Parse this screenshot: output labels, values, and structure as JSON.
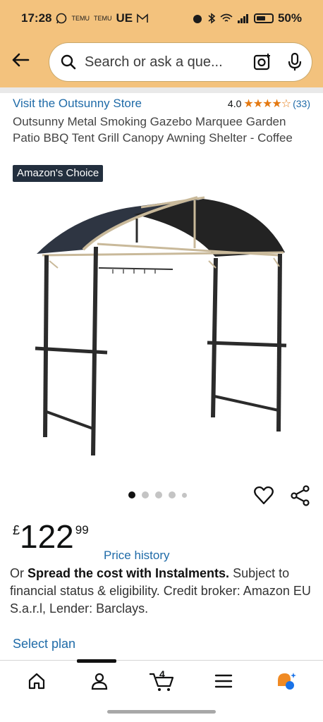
{
  "status_bar": {
    "time": "17:28",
    "left_icons": [
      "whatsapp-icon",
      "temu-icon",
      "temu-icon",
      "UE",
      "gmail-icon"
    ],
    "temu_a": "TEMU",
    "temu_b": "TEMU",
    "ue": "UE",
    "battery": "50%"
  },
  "header": {
    "search_placeholder": "Search or ask a que..."
  },
  "product": {
    "store_link": "Visit the Outsunny Store",
    "rating_value": "4.0",
    "stars": "★★★★☆",
    "review_count": "(33)",
    "title": "Outsunny Metal Smoking Gazebo Marquee Garden Patio BBQ Tent Grill Canopy Awning Shelter - Coffee",
    "badge": "Amazon's Choice",
    "image_count": 5,
    "image_index": 1
  },
  "price": {
    "currency": "£",
    "whole": "122",
    "fraction": "99",
    "history_link": "Price history"
  },
  "instalments": {
    "prefix": "Or ",
    "bold": "Spread the cost with Instalments.",
    "rest_line1": " Subject to",
    "rest_line2": "financial status & eligibility. Credit broker: Amazon EU S.a.r.l, Lender: Barclays.",
    "select_plan": "Select plan"
  },
  "bottom_nav": {
    "cart_count": "4",
    "items": [
      "home-icon",
      "account-icon",
      "cart-icon",
      "menu-icon",
      "rufus-icon"
    ]
  },
  "colors": {
    "header_bg": "#f3c27d",
    "link": "#1f6ba8",
    "star": "#e47911",
    "badge_bg": "#232f3e"
  }
}
